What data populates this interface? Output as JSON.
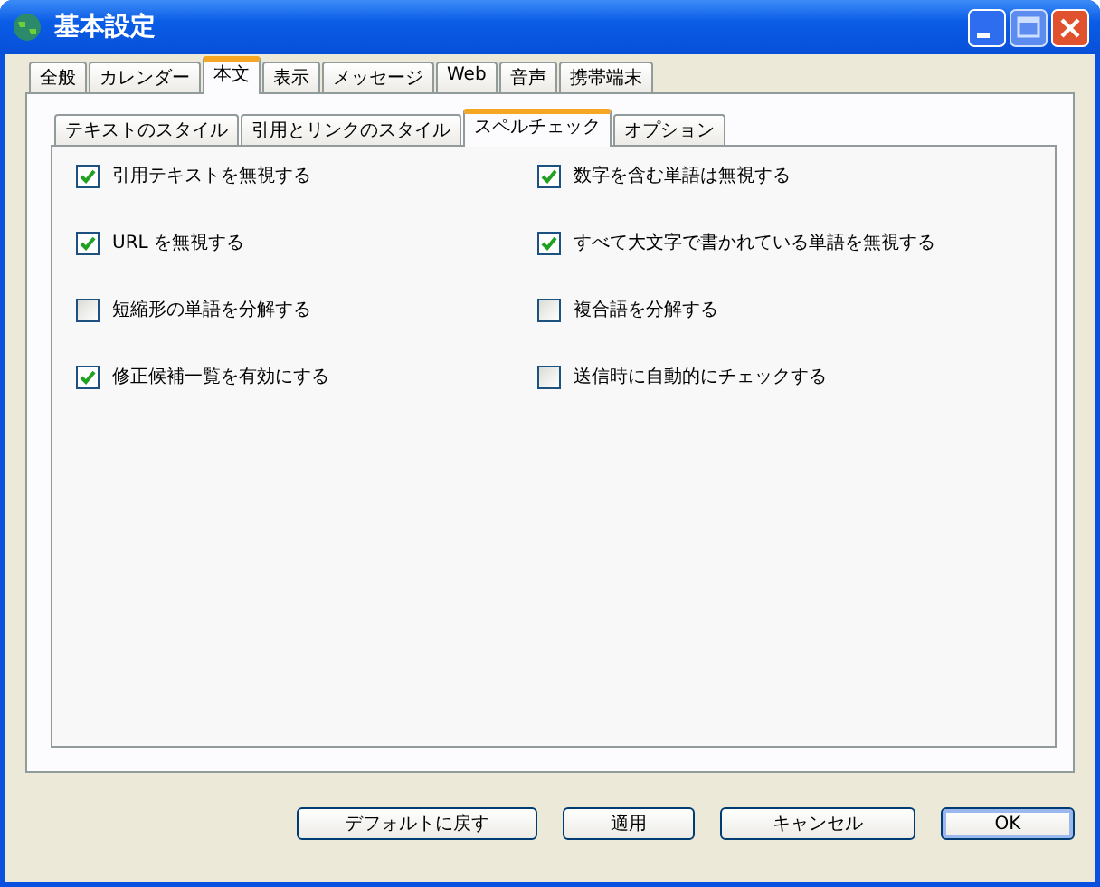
{
  "window": {
    "title": "基本設定"
  },
  "tabs": [
    {
      "label": "全般",
      "selected": false
    },
    {
      "label": "カレンダー",
      "selected": false
    },
    {
      "label": "本文",
      "selected": true
    },
    {
      "label": "表示",
      "selected": false
    },
    {
      "label": "メッセージ",
      "selected": false
    },
    {
      "label": "Web",
      "selected": false
    },
    {
      "label": "音声",
      "selected": false
    },
    {
      "label": "携帯端末",
      "selected": false
    }
  ],
  "subtabs": [
    {
      "label": "テキストのスタイル",
      "selected": false
    },
    {
      "label": "引用とリンクのスタイル",
      "selected": false
    },
    {
      "label": "スペルチェック",
      "selected": true
    },
    {
      "label": "オプション",
      "selected": false
    }
  ],
  "options": [
    {
      "label": "引用テキストを無視する",
      "checked": true
    },
    {
      "label": "数字を含む単語は無視する",
      "checked": true
    },
    {
      "label": "URL を無視する",
      "checked": true
    },
    {
      "label": "すべて大文字で書かれている単語を無視する",
      "checked": true
    },
    {
      "label": "短縮形の単語を分解する",
      "checked": false
    },
    {
      "label": "複合語を分解する",
      "checked": false
    },
    {
      "label": "修正候補一覧を有効にする",
      "checked": true
    },
    {
      "label": "送信時に自動的にチェックする",
      "checked": false
    }
  ],
  "buttons": [
    {
      "label": "デフォルトに戻す",
      "kind": "normal"
    },
    {
      "label": "適用",
      "kind": "normal"
    },
    {
      "label": "キャンセル",
      "kind": "normal"
    },
    {
      "label": "OK",
      "kind": "default"
    }
  ]
}
